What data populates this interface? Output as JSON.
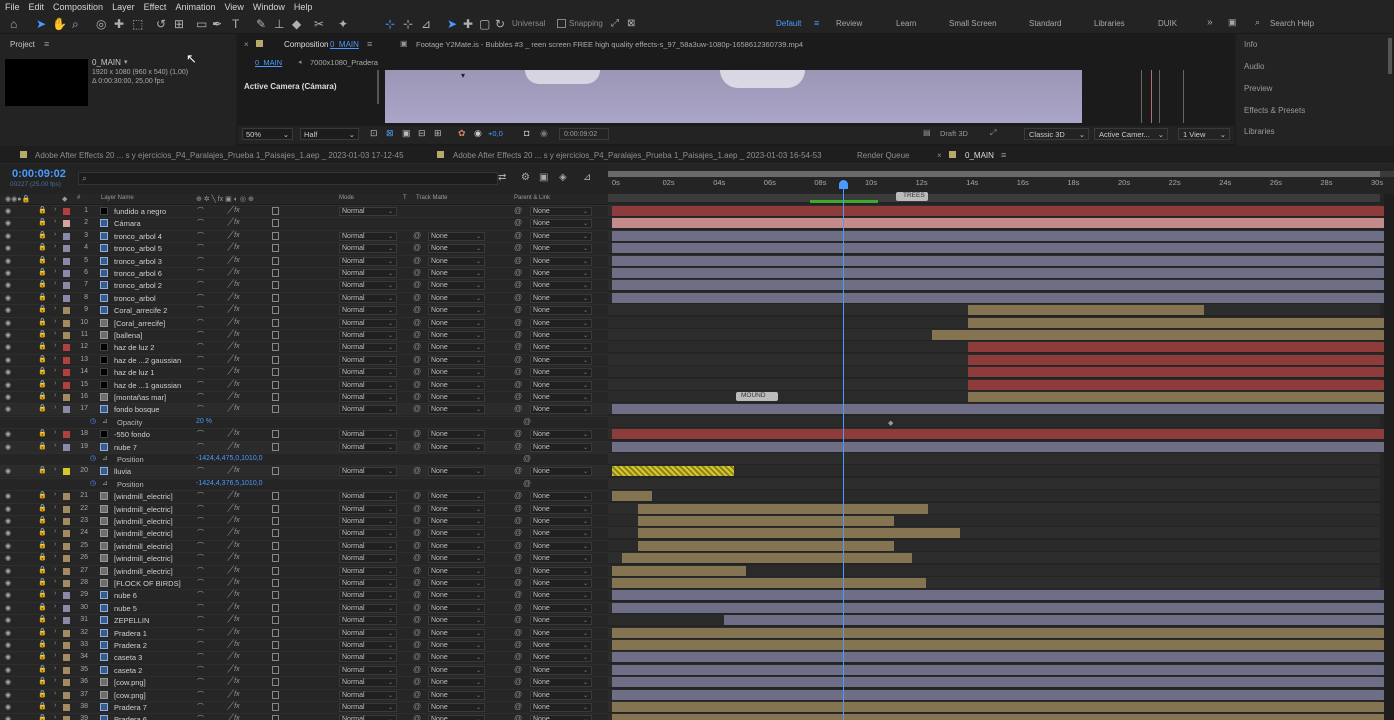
{
  "menu": [
    "File",
    "Edit",
    "Composition",
    "Layer",
    "Effect",
    "Animation",
    "View",
    "Window",
    "Help"
  ],
  "toolbar": {
    "universal": "Universal",
    "snapping": "Snapping",
    "search_placeholder": "Search Help"
  },
  "workspaces": [
    "Default",
    "Review",
    "Learn",
    "Small Screen",
    "Standard",
    "Libraries",
    "DUIK"
  ],
  "project": {
    "title": "Project",
    "item_name": "0_MAIN",
    "item_dims": "1920 x 1080  (960 x 540) (1,00)",
    "item_dur": "Δ 0:00:30:00, 25,00 fps"
  },
  "comp": {
    "tab": "Composition",
    "tab_name": "0_MAIN",
    "footage": "Footage Y2Mate.is - Bubbles #3 _ reen screen FREE high quality effects-s_97_58a3uw-1080p-1658612360739.mp4",
    "sub1": "0_MAIN",
    "sub2": "7000x1080_Pradera",
    "camera_label": "Active Camera (Cámara)",
    "zoom": "50%",
    "res": "Half",
    "exposure": "+0,0",
    "timecode": "0:00:09:02",
    "draft": "Draft 3D",
    "renderer": "Classic 3D",
    "camera": "Active Camer...",
    "view": "1 View"
  },
  "right": [
    "Info",
    "Audio",
    "Preview",
    "Effects & Presets",
    "Libraries"
  ],
  "tabs2": [
    "Adobe After Effects 20 ... s y ejercicios_P4_Paralajes_Prueba 1_Paisajes_1.aep _ 2023-01-03 17-12-45",
    "Adobe After Effects 20 ... s y ejercicios_P4_Paralajes_Prueba 1_Paisajes_1.aep _ 2023-01-03 16-54-53",
    "Render Queue",
    "0_MAIN"
  ],
  "timeline": {
    "timecode": "0:00:09:02",
    "frames": "00227 (25.00 fps)",
    "col_layer": "Layer Name",
    "col_mode": "Mode",
    "col_t": "T",
    "col_track": "Track Matte",
    "col_parent": "Parent & Link",
    "ticks": [
      "0s",
      "02s",
      "04s",
      "06s",
      "08s",
      "10s",
      "12s",
      "14s",
      "16s",
      "18s",
      "20s",
      "22s",
      "24s",
      "26s",
      "28s",
      "30s"
    ],
    "marker_trees": "TREES",
    "marker_mound": "MOUND"
  },
  "layers": [
    {
      "n": "1",
      "name": "fundido a negro",
      "mode": "Normal",
      "tm": "",
      "parent": "None"
    },
    {
      "n": "2",
      "name": "Cámara",
      "mode": "",
      "tm": "",
      "parent": "None"
    },
    {
      "n": "3",
      "name": "tronco_arbol 4",
      "mode": "Normal",
      "tm": "None",
      "parent": "None"
    },
    {
      "n": "4",
      "name": "tronco_arbol 5",
      "mode": "Normal",
      "tm": "None",
      "parent": "None"
    },
    {
      "n": "5",
      "name": "tronco_arbol 3",
      "mode": "Normal",
      "tm": "None",
      "parent": "None"
    },
    {
      "n": "6",
      "name": "tronco_arbol 6",
      "mode": "Normal",
      "tm": "None",
      "parent": "None"
    },
    {
      "n": "7",
      "name": "tronco_arbol 2",
      "mode": "Normal",
      "tm": "None",
      "parent": "None"
    },
    {
      "n": "8",
      "name": "tronco_arbol",
      "mode": "Normal",
      "tm": "None",
      "parent": "None"
    },
    {
      "n": "9",
      "name": "Coral_arrecife 2",
      "mode": "Normal",
      "tm": "None",
      "parent": "None"
    },
    {
      "n": "10",
      "name": "[Coral_arrecife]",
      "mode": "Normal",
      "tm": "None",
      "parent": "None"
    },
    {
      "n": "11",
      "name": "[ballena]",
      "mode": "Normal",
      "tm": "None",
      "parent": "None"
    },
    {
      "n": "12",
      "name": "haz de luz 2",
      "mode": "Normal",
      "tm": "None",
      "parent": "None"
    },
    {
      "n": "13",
      "name": "haz de ...2 gaussian",
      "mode": "Normal",
      "tm": "None",
      "parent": "None"
    },
    {
      "n": "14",
      "name": "haz de luz 1",
      "mode": "Normal",
      "tm": "None",
      "parent": "None"
    },
    {
      "n": "15",
      "name": "haz de ...1 gaussian",
      "mode": "Normal",
      "tm": "None",
      "parent": "None"
    },
    {
      "n": "16",
      "name": "[montañas mar]",
      "mode": "Normal",
      "tm": "None",
      "parent": "None"
    },
    {
      "n": "17",
      "name": "fondo bosque",
      "mode": "Normal",
      "tm": "None",
      "parent": "None"
    },
    {
      "prop": "Opacity",
      "val": "20 %"
    },
    {
      "n": "18",
      "name": "-550 fondo",
      "mode": "Normal",
      "tm": "None",
      "parent": "None"
    },
    {
      "n": "19",
      "name": "nube 7",
      "mode": "Normal",
      "tm": "None",
      "parent": "None"
    },
    {
      "prop": "Position",
      "val": "-1424,4,475,0,1010,0"
    },
    {
      "n": "20",
      "name": "lluvia",
      "mode": "Normal",
      "tm": "None",
      "parent": "None"
    },
    {
      "prop": "Position",
      "val": "-1424,4,376,5,1010,0"
    },
    {
      "n": "21",
      "name": "[windmill_electric]",
      "mode": "Normal",
      "tm": "None",
      "parent": "None"
    },
    {
      "n": "22",
      "name": "[windmill_electric]",
      "mode": "Normal",
      "tm": "None",
      "parent": "None"
    },
    {
      "n": "23",
      "name": "[windmill_electric]",
      "mode": "Normal",
      "tm": "None",
      "parent": "None"
    },
    {
      "n": "24",
      "name": "[windmill_electric]",
      "mode": "Normal",
      "tm": "None",
      "parent": "None"
    },
    {
      "n": "25",
      "name": "[windmill_electric]",
      "mode": "Normal",
      "tm": "None",
      "parent": "None"
    },
    {
      "n": "26",
      "name": "[windmill_electric]",
      "mode": "Normal",
      "tm": "None",
      "parent": "None"
    },
    {
      "n": "27",
      "name": "[windmill_electric]",
      "mode": "Normal",
      "tm": "None",
      "parent": "None"
    },
    {
      "n": "28",
      "name": "[FLOCK OF BIRDS]",
      "mode": "Normal",
      "tm": "None",
      "parent": "None"
    },
    {
      "n": "29",
      "name": "nube 6",
      "mode": "Normal",
      "tm": "None",
      "parent": "None"
    },
    {
      "n": "30",
      "name": "nube 5",
      "mode": "Normal",
      "tm": "None",
      "parent": "None"
    },
    {
      "n": "31",
      "name": "ZEPELLIN",
      "mode": "Normal",
      "tm": "None",
      "parent": "None"
    },
    {
      "n": "32",
      "name": "Pradera 1",
      "mode": "Normal",
      "tm": "None",
      "parent": "None"
    },
    {
      "n": "33",
      "name": "Pradera 2",
      "mode": "Normal",
      "tm": "None",
      "parent": "None"
    },
    {
      "n": "34",
      "name": "caseta 3",
      "mode": "Normal",
      "tm": "None",
      "parent": "None"
    },
    {
      "n": "35",
      "name": "caseta 2",
      "mode": "Normal",
      "tm": "None",
      "parent": "None"
    },
    {
      "n": "36",
      "name": "[cow.png]",
      "mode": "Normal",
      "tm": "None",
      "parent": "None"
    },
    {
      "n": "37",
      "name": "[cow.png]",
      "mode": "Normal",
      "tm": "None",
      "parent": "None"
    },
    {
      "n": "38",
      "name": "Pradera 7",
      "mode": "Normal",
      "tm": "None",
      "parent": "None"
    },
    {
      "n": "39",
      "name": "Pradera 6",
      "mode": "Normal",
      "tm": "None",
      "parent": "None"
    }
  ]
}
